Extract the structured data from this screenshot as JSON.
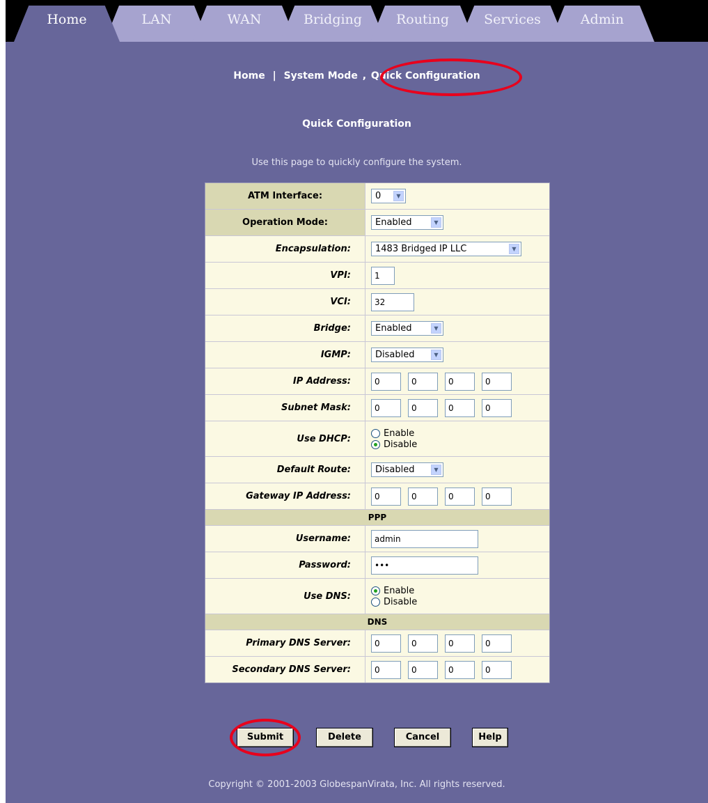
{
  "tabs": [
    "Home",
    "LAN",
    "WAN",
    "Bridging",
    "Routing",
    "Services",
    "Admin"
  ],
  "breadcrumb": {
    "home": "Home",
    "separator": "|",
    "system_mode": "System Mode",
    "current": "Quick Configuration"
  },
  "page": {
    "title": "Quick Configuration",
    "description": "Use this page to quickly configure the system."
  },
  "form": {
    "atm_interface": {
      "label": "ATM Interface:",
      "value": "0"
    },
    "operation_mode": {
      "label": "Operation Mode:",
      "value": "Enabled"
    },
    "encapsulation": {
      "label": "Encapsulation:",
      "value": "1483 Bridged IP LLC"
    },
    "vpi": {
      "label": "VPI:",
      "value": "1"
    },
    "vci": {
      "label": "VCI:",
      "value": "32"
    },
    "bridge": {
      "label": "Bridge:",
      "value": "Enabled"
    },
    "igmp": {
      "label": "IGMP:",
      "value": "Disabled"
    },
    "ip_address": {
      "label": "IP Address:",
      "octets": [
        "0",
        "0",
        "0",
        "0"
      ]
    },
    "subnet_mask": {
      "label": "Subnet Mask:",
      "octets": [
        "0",
        "0",
        "0",
        "0"
      ]
    },
    "use_dhcp": {
      "label": "Use DHCP:",
      "options": [
        "Enable",
        "Disable"
      ],
      "selected": "Disable"
    },
    "default_route": {
      "label": "Default Route:",
      "value": "Disabled"
    },
    "gateway_ip": {
      "label": "Gateway IP Address:",
      "octets": [
        "0",
        "0",
        "0",
        "0"
      ]
    },
    "ppp_section": "PPP",
    "username": {
      "label": "Username:",
      "value": "admin"
    },
    "password": {
      "label": "Password:",
      "value": "•••"
    },
    "use_dns": {
      "label": "Use DNS:",
      "options": [
        "Enable",
        "Disable"
      ],
      "selected": "Enable"
    },
    "dns_section": "DNS",
    "primary_dns": {
      "label": "Primary DNS Server:",
      "octets": [
        "0",
        "0",
        "0",
        "0"
      ]
    },
    "secondary_dns": {
      "label": "Secondary DNS Server:",
      "octets": [
        "0",
        "0",
        "0",
        "0"
      ]
    }
  },
  "buttons": {
    "submit": "Submit",
    "delete": "Delete",
    "cancel": "Cancel",
    "help": "Help"
  },
  "footer": "Copyright © 2001-2003 GlobespanVirata, Inc. All rights reserved.",
  "colors": {
    "page_bg": "#67669a",
    "tab_bg": "#a6a3cf",
    "form_bg": "#fbf9e3",
    "highlight_label_bg": "#d9d8b2",
    "annotation_ring": "#e8001c"
  }
}
